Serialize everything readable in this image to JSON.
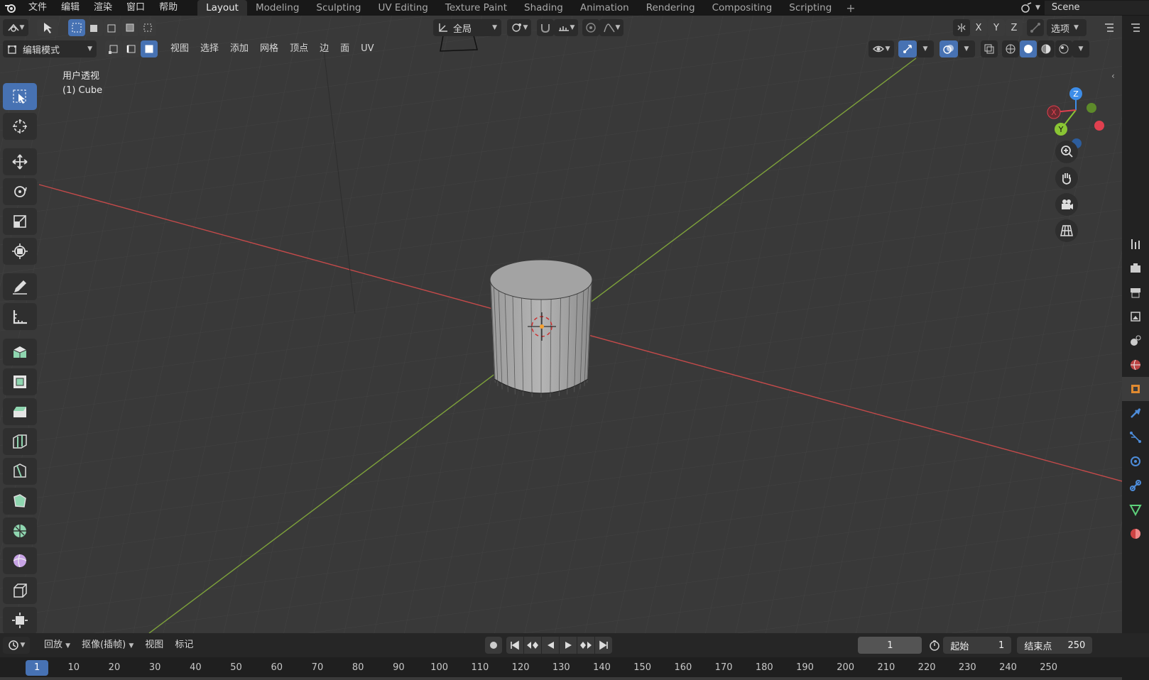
{
  "menu": {
    "items": [
      "文件",
      "编辑",
      "渲染",
      "窗口",
      "帮助"
    ]
  },
  "workspaces": {
    "tabs": [
      "Layout",
      "Modeling",
      "Sculpting",
      "UV Editing",
      "Texture Paint",
      "Shading",
      "Animation",
      "Rendering",
      "Compositing",
      "Scripting"
    ],
    "active": "Layout",
    "add_label": "+"
  },
  "scene": {
    "name": "Scene"
  },
  "header1": {
    "transform_orientation": "全局",
    "axes": [
      "X",
      "Y",
      "Z"
    ],
    "options_label": "选项"
  },
  "header2": {
    "mode": "编辑模式",
    "menus": [
      "视图",
      "选择",
      "添加",
      "网格",
      "顶点",
      "边",
      "面",
      "UV"
    ]
  },
  "viewport": {
    "view_name": "用户透视",
    "object_name": "(1) Cube",
    "gizmo": {
      "x": "X",
      "y": "Y",
      "z": "Z"
    }
  },
  "colors": {
    "x_axis": "#c44a4a",
    "y_axis": "#7ea23a",
    "accent": "#4772b3",
    "gizmo_x": "#e0404f",
    "gizmo_y": "#8ac534",
    "gizmo_z": "#3d8de8"
  },
  "icons": {
    "tools": [
      "select-box-icon",
      "cursor-icon",
      "move-icon",
      "rotate-icon",
      "scale-icon",
      "transform-icon",
      "annotate-icon",
      "measure-icon",
      "extrude-icon",
      "inset-icon",
      "bevel-icon",
      "loop-cut-icon",
      "knife-icon",
      "poly-build-icon",
      "spin-icon",
      "smooth-icon",
      "edge-slide-icon",
      "shrink-fatten-icon"
    ],
    "props": [
      "tool-icon",
      "render-icon",
      "output-icon",
      "view-layer-icon",
      "scene-icon",
      "world-icon",
      "object-icon",
      "modifier-icon",
      "particles-icon",
      "physics-icon",
      "constraints-icon",
      "data-icon",
      "material-icon"
    ]
  },
  "timeline": {
    "menus": [
      "回放",
      "抠像(插帧)",
      "视图",
      "标记"
    ],
    "current_frame": "1",
    "start_label": "起始",
    "start_value": "1",
    "end_label": "结束点",
    "end_value": "250",
    "ticks": [
      "1",
      "10",
      "20",
      "30",
      "40",
      "50",
      "60",
      "70",
      "80",
      "90",
      "100",
      "110",
      "120",
      "130",
      "140",
      "150",
      "160",
      "170",
      "180",
      "190",
      "200",
      "210",
      "220",
      "230",
      "240",
      "250"
    ]
  }
}
